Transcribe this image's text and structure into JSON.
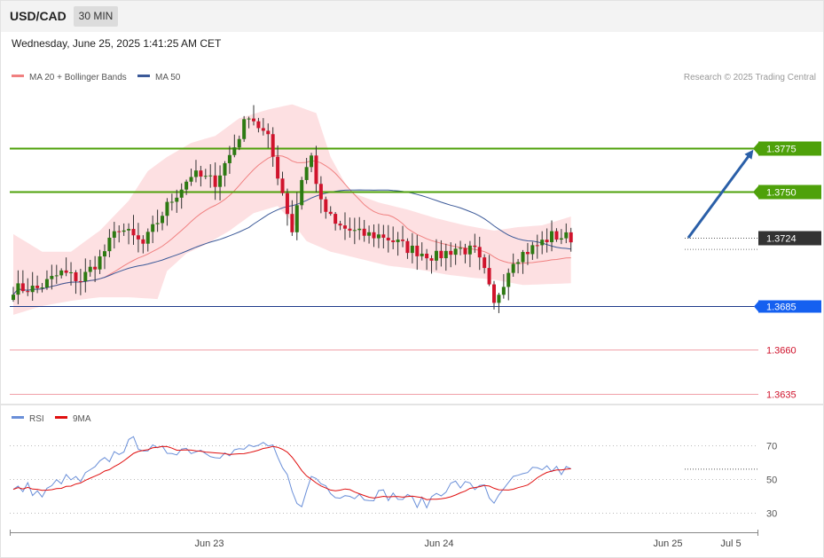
{
  "header": {
    "symbol": "USD/CAD",
    "timeframe": "30 MIN",
    "datetime": "Wednesday, June 25, 2025 1:41:25 AM CET"
  },
  "legend": {
    "ma20_bb": "MA 20 + Bollinger Bands",
    "ma50": "MA 50",
    "credit": "Research © 2025 Trading Central",
    "rsi": "RSI",
    "rsi_ma": "9MA"
  },
  "colors": {
    "up": "#2d7a12",
    "down": "#d0132c",
    "resistance": "#4ea10a",
    "support": "#1e3a8a",
    "support_label": "#1560f0",
    "lower": "#f0a0a8",
    "lower_text": "#d0132c",
    "bb_fill": "#fde0e2",
    "ma20": "#f08080",
    "ma50": "#3b5998",
    "rsi": "#6a8fd8",
    "rsi_ma": "#e01010",
    "arrow": "#2a5fa8"
  },
  "chart_data": {
    "type": "candlestick",
    "y_range": [
      1.3628,
      1.3808
    ],
    "last_price": "1.3724",
    "levels": [
      {
        "value": 1.3775,
        "label": "1.3775",
        "kind": "resistance"
      },
      {
        "value": 1.375,
        "label": "1.3750",
        "kind": "resistance"
      },
      {
        "value": 1.3724,
        "label": "1.3724",
        "kind": "last"
      },
      {
        "value": 1.3685,
        "label": "1.3685",
        "kind": "support"
      },
      {
        "value": 1.366,
        "label": "1.3660",
        "kind": "lower"
      },
      {
        "value": 1.3635,
        "label": "1.3635",
        "kind": "lower"
      }
    ],
    "x_labels": [
      "Jun 23",
      "Jun 24",
      "Jun 25",
      "Jul 5"
    ],
    "rsi_ticks": [
      "70",
      "50",
      "30"
    ],
    "rsi_range": [
      22,
      78
    ],
    "anchors": [
      [
        0,
        1.3695
      ],
      [
        5,
        1.3695
      ],
      [
        10,
        1.3704
      ],
      [
        14,
        1.37
      ],
      [
        18,
        1.3712
      ],
      [
        22,
        1.373
      ],
      [
        27,
        1.372
      ],
      [
        32,
        1.3742
      ],
      [
        37,
        1.376
      ],
      [
        42,
        1.3756
      ],
      [
        46,
        1.3776
      ],
      [
        49,
        1.3795
      ],
      [
        53,
        1.378
      ],
      [
        56,
        1.375
      ],
      [
        58,
        1.3728
      ],
      [
        60,
        1.3758
      ],
      [
        62,
        1.377
      ],
      [
        64,
        1.3743
      ],
      [
        67,
        1.3731
      ],
      [
        72,
        1.3726
      ],
      [
        77,
        1.3725
      ],
      [
        82,
        1.3718
      ],
      [
        88,
        1.3713
      ],
      [
        92,
        1.3718
      ],
      [
        96,
        1.3716
      ],
      [
        98,
        1.3704
      ],
      [
        100,
        1.3685
      ],
      [
        101,
        1.3693
      ],
      [
        104,
        1.3712
      ],
      [
        108,
        1.3718
      ],
      [
        112,
        1.3725
      ],
      [
        116,
        1.3724
      ]
    ],
    "rsi_anchors": [
      [
        0,
        43
      ],
      [
        3,
        45
      ],
      [
        6,
        40
      ],
      [
        10,
        50
      ],
      [
        14,
        49
      ],
      [
        18,
        58
      ],
      [
        22,
        67
      ],
      [
        25,
        72
      ],
      [
        30,
        66
      ],
      [
        35,
        68
      ],
      [
        40,
        67
      ],
      [
        45,
        64
      ],
      [
        50,
        70
      ],
      [
        54,
        67
      ],
      [
        58,
        45
      ],
      [
        60,
        32
      ],
      [
        62,
        52
      ],
      [
        64,
        48
      ],
      [
        67,
        42
      ],
      [
        72,
        40
      ],
      [
        77,
        41
      ],
      [
        82,
        38
      ],
      [
        86,
        35
      ],
      [
        88,
        42
      ],
      [
        92,
        47
      ],
      [
        96,
        45
      ],
      [
        98,
        48
      ],
      [
        100,
        33
      ],
      [
        103,
        48
      ],
      [
        107,
        52
      ],
      [
        110,
        57
      ],
      [
        113,
        55
      ],
      [
        116,
        55
      ]
    ],
    "bb_upper": [
      [
        0,
        1.3726
      ],
      [
        6,
        1.3716
      ],
      [
        12,
        1.3716
      ],
      [
        18,
        1.3728
      ],
      [
        24,
        1.3745
      ],
      [
        28,
        1.3762
      ],
      [
        32,
        1.377
      ],
      [
        37,
        1.3778
      ],
      [
        42,
        1.3782
      ],
      [
        47,
        1.3792
      ],
      [
        53,
        1.3797
      ],
      [
        58,
        1.38
      ],
      [
        63,
        1.3795
      ],
      [
        66,
        1.377
      ],
      [
        70,
        1.375
      ],
      [
        76,
        1.3744
      ],
      [
        82,
        1.374
      ],
      [
        88,
        1.3735
      ],
      [
        94,
        1.3731
      ],
      [
        100,
        1.3728
      ],
      [
        105,
        1.373
      ],
      [
        110,
        1.3731
      ],
      [
        116,
        1.3736
      ]
    ],
    "bb_lower": [
      [
        0,
        1.368
      ],
      [
        6,
        1.3685
      ],
      [
        12,
        1.3688
      ],
      [
        18,
        1.369
      ],
      [
        24,
        1.369
      ],
      [
        30,
        1.3689
      ],
      [
        32,
        1.3705
      ],
      [
        36,
        1.3715
      ],
      [
        40,
        1.372
      ],
      [
        45,
        1.3728
      ],
      [
        50,
        1.3738
      ],
      [
        55,
        1.3742
      ],
      [
        58,
        1.3733
      ],
      [
        61,
        1.3722
      ],
      [
        66,
        1.3716
      ],
      [
        72,
        1.3712
      ],
      [
        78,
        1.3708
      ],
      [
        84,
        1.3706
      ],
      [
        90,
        1.3703
      ],
      [
        96,
        1.3701
      ],
      [
        100,
        1.37
      ],
      [
        106,
        1.3697
      ],
      [
        116,
        1.3698
      ]
    ]
  }
}
